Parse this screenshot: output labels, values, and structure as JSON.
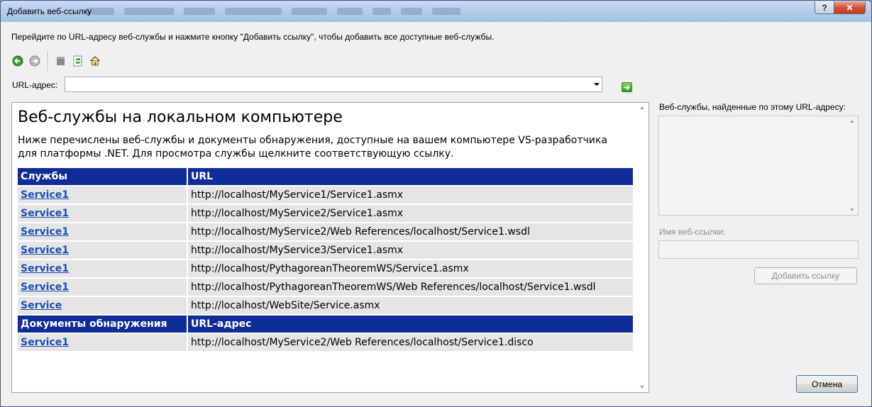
{
  "window": {
    "title": "Добавить веб-ссылку",
    "help_label": "?",
    "close_label": "✕"
  },
  "instruction": "Перейдите по URL-адресу веб-службы и нажмите кнопку \"Добавить ссылку\", чтобы добавить все доступные веб-службы.",
  "toolbar": {
    "icons": [
      "back-icon",
      "forward-icon",
      "stop-icon",
      "refresh-icon",
      "home-icon"
    ]
  },
  "url": {
    "label": "URL-адрес:",
    "value": ""
  },
  "page": {
    "heading": "Веб-службы на локальном компьютере",
    "description": "Ниже перечислены веб-службы и документы обнаружения, доступные на вашем компьютере VS-разработчика для платформы .NET. Для просмотра службы щелкните соответствующую ссылку.",
    "services_header": {
      "col1": "Службы",
      "col2": "URL"
    },
    "services": [
      {
        "name": "Service1",
        "url": "http://localhost/MyService1/Service1.asmx"
      },
      {
        "name": "Service1",
        "url": "http://localhost/MyService2/Service1.asmx"
      },
      {
        "name": "Service1",
        "url": "http://localhost/MyService2/Web References/localhost/Service1.wsdl"
      },
      {
        "name": "Service1",
        "url": "http://localhost/MyService3/Service1.asmx"
      },
      {
        "name": "Service1",
        "url": "http://localhost/PythagoreanTheoremWS/Service1.asmx"
      },
      {
        "name": "Service1",
        "url": "http://localhost/PythagoreanTheoremWS/Web References/localhost/Service1.wsdl"
      },
      {
        "name": "Service",
        "url": "http://localhost/WebSite/Service.asmx"
      }
    ],
    "discovery_header": {
      "col1": "Документы обнаружения",
      "col2": "URL-адрес"
    },
    "discovery": [
      {
        "name": "Service1",
        "url": "http://localhost/MyService2/Web References/localhost/Service1.disco"
      }
    ]
  },
  "right_panel": {
    "found_label": "Веб-службы, найденные по этому URL-адресу:",
    "name_label": "Имя веб-ссылки:",
    "name_value": "",
    "add_button": "Добавить ссылку",
    "cancel_button": "Отмена"
  }
}
